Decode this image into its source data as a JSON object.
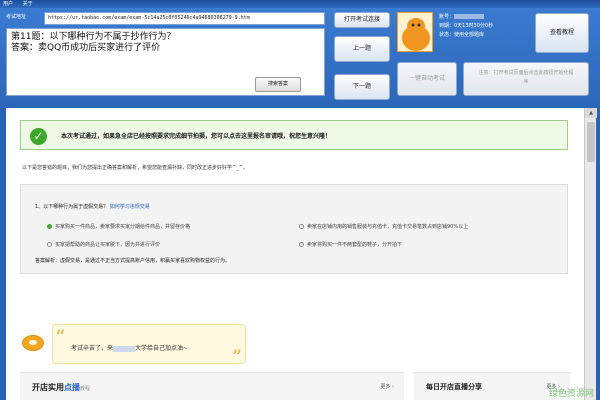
{
  "window": {
    "menu": [
      "用户",
      "关于"
    ]
  },
  "toolbar": {
    "url_label": "考试地址",
    "url_value": "https://ur.taobao.com/exam/exam-5c14a25c0f05246c4a94680306279-9.htm",
    "question_lines": [
      "第11题：以下哪种行为不属于抄作行为？",
      "答案：卖QQ币成功后买家进行了评价"
    ],
    "search_answer": "搜索答案",
    "open_exam": "打开考试连接",
    "prev": "上一题",
    "next": "下一题",
    "auto_exam": "一键自动考试",
    "tip": "注意：打开考试页面后点击此按钮开始化程序",
    "view_tutorial": "查看教程"
  },
  "user": {
    "account_label": "账号：",
    "expiry": "到期：0天13时30分0秒",
    "status_label": "状态：",
    "status_value": "使用全部题库"
  },
  "result": {
    "message": "本次考试通过，如果急全店已经按照要求完成细节拍摄，您可以点去这里报名审请哦，祝您生意兴隆！",
    "note": "以下是您答错的题目，我们为您提出正确答案和解析，希望您能查漏补缺，同时改正进步好好学^_^。"
  },
  "question": {
    "title_prefix": "1、以下哪种行为属于虚假交易？",
    "title_link": "如何学习违规交易",
    "options": [
      {
        "text": "买家购买一件商品，卖家要求买家分期给件商品，并留存价格",
        "checked": true
      },
      {
        "text": "卖家在店铺内用的销售服装与充值卡，充值卡交易笔数占到店铺90%以上",
        "checked": false
      },
      {
        "text": "买家把帮助的商品让买家脱下，因为并进行评价",
        "checked": false
      },
      {
        "text": "卖家将购买一件不两套型的鞋子，分开拍下",
        "checked": false
      }
    ],
    "answer": "答案解析：虚假交易，是通过不正当方式提高账户信用，积赢买家喜欢购物权益的行为。"
  },
  "cheer": {
    "prefix": "考试辛苦了，来",
    "suffix": "大学给自己加点油~"
  },
  "cards": [
    {
      "title_main": "开店实用",
      "title_colored": "点播",
      "title_sub": "教程",
      "more": "更多 ›"
    },
    {
      "title_main": "每日开店直播分享",
      "title_colored": "",
      "title_sub": "",
      "more": "更多 ›"
    }
  ],
  "watermark": "绿色资源网"
}
